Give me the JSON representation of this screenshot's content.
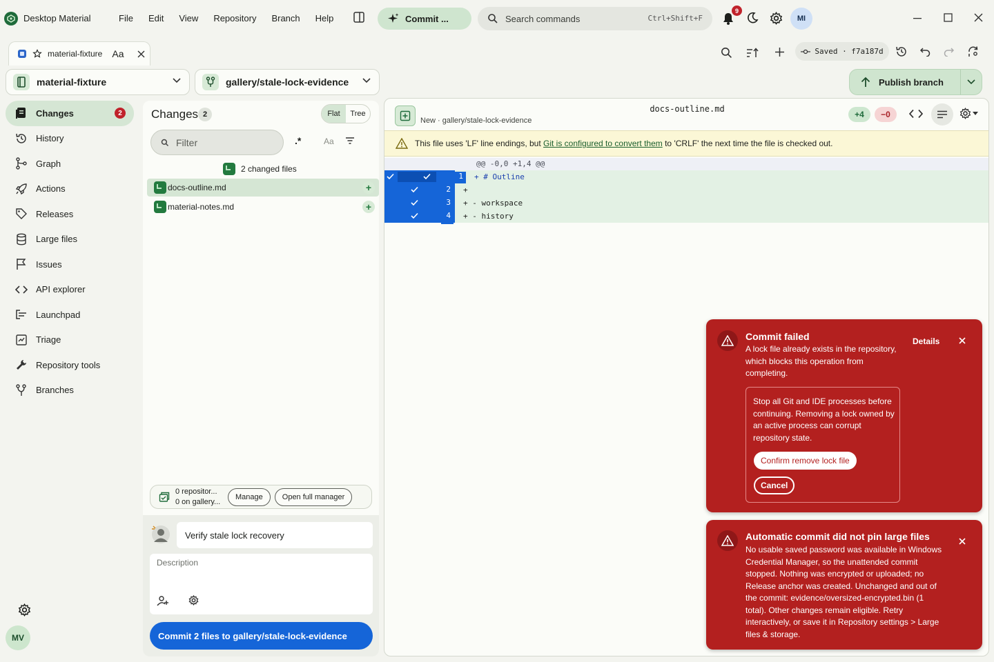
{
  "app": {
    "name": "Desktop Material",
    "menu": [
      "File",
      "Edit",
      "View",
      "Repository",
      "Branch",
      "Help"
    ],
    "commit_pill": "Commit ...",
    "search_placeholder": "Search commands",
    "search_shortcut": "Ctrl+Shift+F",
    "notification_count": "9",
    "user_initials": "MI"
  },
  "tab": {
    "label": "material-fixture",
    "font_toggle": "Aa"
  },
  "toolbar": {
    "saved_text": "Saved · f7a187d"
  },
  "repo_selector": {
    "label": "material-fixture"
  },
  "branch_selector": {
    "label": "gallery/stale-lock-evidence"
  },
  "publish": {
    "label": "Publish branch"
  },
  "nav": {
    "items": [
      {
        "label": "Changes",
        "icon": "changes-icon",
        "badge": "2"
      },
      {
        "label": "History",
        "icon": "history-icon"
      },
      {
        "label": "Graph",
        "icon": "graph-icon"
      },
      {
        "label": "Actions",
        "icon": "rocket-icon"
      },
      {
        "label": "Releases",
        "icon": "tag-icon"
      },
      {
        "label": "Large files",
        "icon": "database-icon"
      },
      {
        "label": "Issues",
        "icon": "flag-icon"
      },
      {
        "label": "API explorer",
        "icon": "code-icon"
      },
      {
        "label": "Launchpad",
        "icon": "launchpad-icon"
      },
      {
        "label": "Triage",
        "icon": "triage-icon"
      },
      {
        "label": "Repository tools",
        "icon": "wrench-icon"
      },
      {
        "label": "Branches",
        "icon": "branches-icon"
      }
    ],
    "bottom_initials": "MV"
  },
  "changes": {
    "title": "Changes",
    "count": "2",
    "view_flat": "Flat",
    "view_tree": "Tree",
    "filter_placeholder": "Filter",
    "regex_label": ".*",
    "case_label": "Aa",
    "summary": "2 changed files",
    "files": [
      "docs-outline.md",
      "material-notes.md"
    ],
    "stash_line1": "0 repositor...",
    "stash_line2": "0 on gallery...",
    "manage_label": "Manage",
    "open_manager_label": "Open full manager",
    "commit_summary": "Verify stale lock recovery",
    "description_placeholder": "Description",
    "commit_button": "Commit 2 files to gallery/stale-lock-evidence"
  },
  "diff": {
    "file_name": "docs-outline.md",
    "subtitle": "New · gallery/stale-lock-evidence",
    "additions": "+4",
    "deletions": "−0",
    "warning_pre": "This file uses 'LF' line endings, but ",
    "warning_link": "Git is configured to convert them",
    "warning_post": " to 'CRLF' the next time the file is checked out.",
    "hunk_header": "@@ -0,0 +1,4 @@",
    "lines": [
      {
        "num": "1",
        "code": "+  # Outline"
      },
      {
        "num": "2",
        "code": "+"
      },
      {
        "num": "3",
        "code": "+  - workspace"
      },
      {
        "num": "4",
        "code": "+  - history"
      }
    ]
  },
  "toast_commit_failed": {
    "title": "Commit failed",
    "details_label": "Details",
    "body": "A lock file already exists in the repository, which blocks this operation from completing.",
    "warning": "Stop all Git and IDE processes before continuing. Removing a lock owned by an active process can corrupt repository state.",
    "confirm_label": "Confirm remove lock file",
    "cancel_label": "Cancel"
  },
  "toast_large_files": {
    "title": "Automatic commit did not pin large files",
    "body": "No usable saved password was available in Windows Credential Manager, so the unattended commit stopped. Nothing was encrypted or uploaded; no Release anchor was created. Unchanged and out of the commit: evidence/oversized-encrypted.bin (1 total). Other changes remain eligible. Retry interactively, or save it in Repository settings > Large files & storage."
  },
  "colors": {
    "accent_green": "#cfe5cf",
    "primary_blue": "#1565d8",
    "error_red": "#b3201f",
    "badge_red": "#c0222b"
  }
}
